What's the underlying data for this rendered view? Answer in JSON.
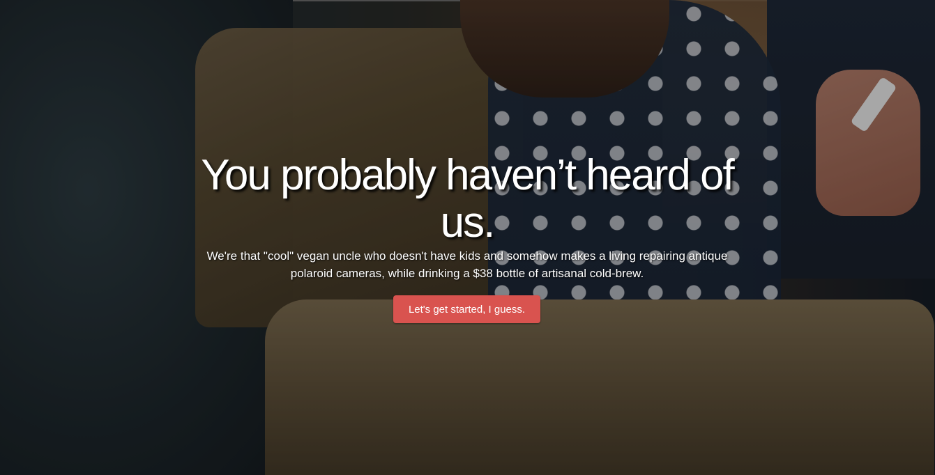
{
  "hero": {
    "headline": "You probably haven’t heard of us.",
    "subtext": "We're that \"cool\" vegan uncle who doesn't have kids and somehow makes a living repairing antique polaroid cameras, while drinking a $38 bottle of artisanal cold-brew.",
    "cta_label": "Let's get started, I guess."
  },
  "colors": {
    "cta_background": "#d9534f",
    "text": "#ffffff"
  }
}
